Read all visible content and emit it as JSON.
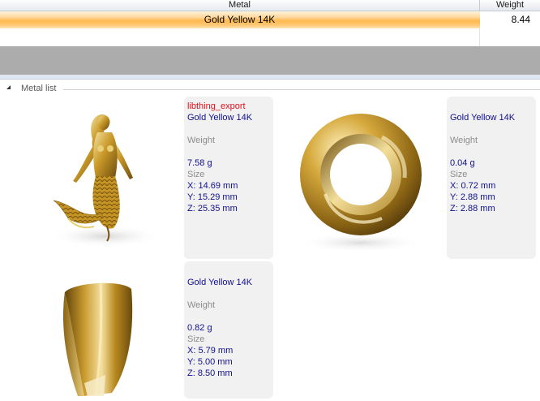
{
  "table": {
    "columns": {
      "metal": "Metal",
      "weight": "Weight"
    },
    "rows": [
      {
        "metal": "Gold Yellow 14K",
        "weight": "8.44"
      }
    ]
  },
  "group": {
    "label": "Metal list"
  },
  "cards": [
    {
      "project": "libthing_export",
      "metal": "Gold Yellow 14K",
      "weight_label": "Weight",
      "weight": "7.58 g",
      "size_label": "Size",
      "x": "X: 14.69 mm",
      "y": "Y: 15.29 mm",
      "z": "Z: 25.35 mm",
      "image": "mermaid-pendant"
    },
    {
      "project": "",
      "metal": "Gold Yellow 14K",
      "weight_label": "Weight",
      "weight": "0.04 g",
      "size_label": "Size",
      "x": "X: 0.72 mm",
      "y": "Y: 2.88 mm",
      "z": "Z: 2.88 mm",
      "image": "jump-ring"
    },
    {
      "project": "",
      "metal": "Gold Yellow 14K",
      "weight_label": "Weight",
      "weight": "0.82 g",
      "size_label": "Size",
      "x": "X: 5.79 mm",
      "y": "Y: 5.00 mm",
      "z": "Z: 8.50 mm",
      "image": "bail"
    }
  ],
  "colors": {
    "selection": "#ffb84e",
    "info_bg": "#f1f1f1",
    "value_text": "#10108c",
    "project_text": "#e1101b",
    "gold": "#c79b2a"
  }
}
